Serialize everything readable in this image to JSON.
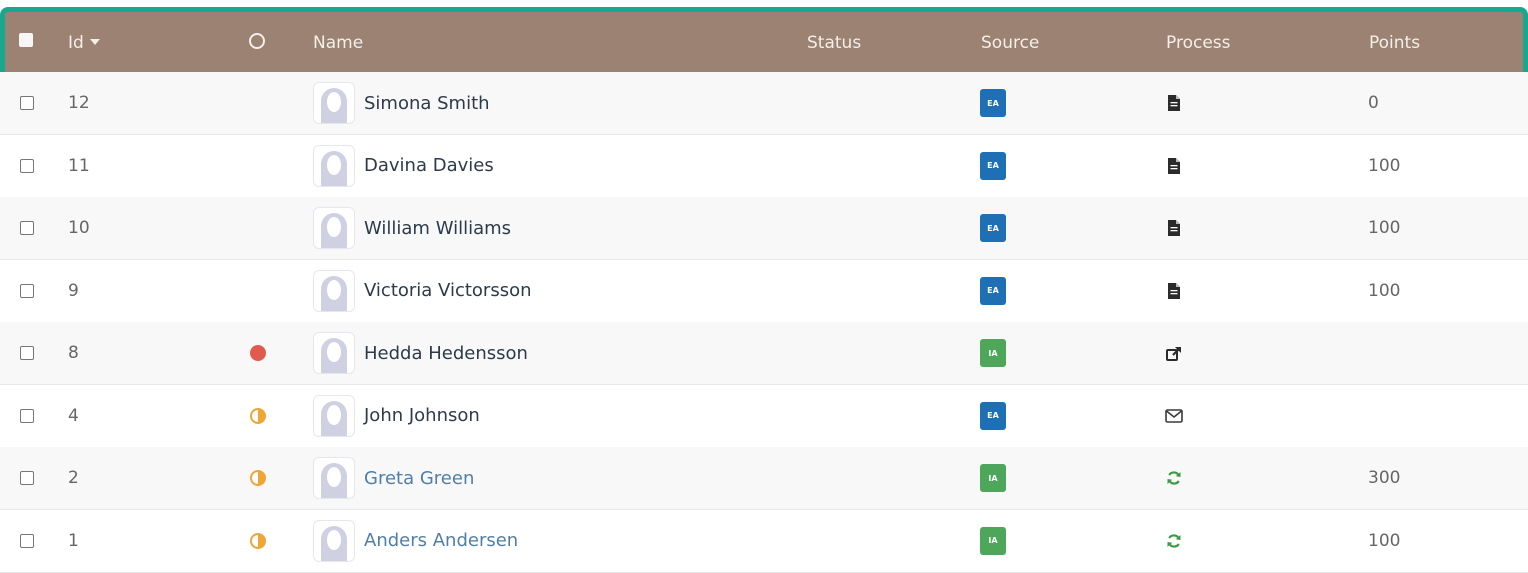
{
  "header": {
    "id_label": "Id",
    "name_label": "Name",
    "status_label": "Status",
    "source_label": "Source",
    "process_label": "Process",
    "points_label": "Points"
  },
  "colors": {
    "header_bg": "#9b8272",
    "highlight_border": "#17a88f",
    "ea_badge": "#1f6fb5",
    "ia_badge": "#4ea65a",
    "state_red": "#e05a4e",
    "state_orange": "#f0a637",
    "link_name": "#4f7fa8"
  },
  "rows": [
    {
      "id": "12",
      "state": "none",
      "name": "Simona Smith",
      "name_link": false,
      "source": "EA",
      "process_icon": "document-icon",
      "points": "0"
    },
    {
      "id": "11",
      "state": "none",
      "name": "Davina Davies",
      "name_link": false,
      "source": "EA",
      "process_icon": "document-icon",
      "points": "100"
    },
    {
      "id": "10",
      "state": "none",
      "name": "William Williams",
      "name_link": false,
      "source": "EA",
      "process_icon": "document-icon",
      "points": "100"
    },
    {
      "id": "9",
      "state": "none",
      "name": "Victoria Victorsson",
      "name_link": false,
      "source": "EA",
      "process_icon": "document-icon",
      "points": "100"
    },
    {
      "id": "8",
      "state": "red-dot",
      "name": "Hedda Hedensson",
      "name_link": false,
      "source": "IA",
      "process_icon": "share-icon",
      "points": ""
    },
    {
      "id": "4",
      "state": "half-circle",
      "name": "John Johnson",
      "name_link": false,
      "source": "EA",
      "process_icon": "envelope-icon",
      "points": ""
    },
    {
      "id": "2",
      "state": "half-circle",
      "name": "Greta Green",
      "name_link": true,
      "source": "IA",
      "process_icon": "refresh-icon",
      "points": "300"
    },
    {
      "id": "1",
      "state": "half-circle",
      "name": "Anders Andersen",
      "name_link": true,
      "source": "IA",
      "process_icon": "refresh-icon",
      "points": "100"
    }
  ]
}
